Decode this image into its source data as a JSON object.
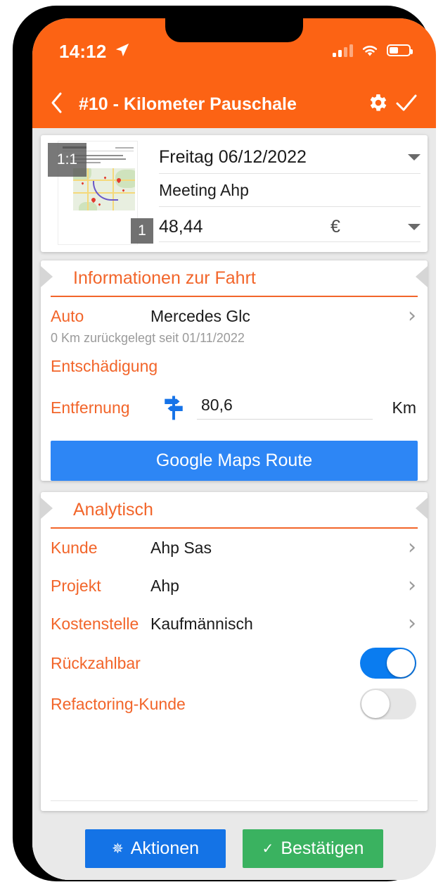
{
  "statusbar": {
    "time": "14:12",
    "location_icon": "location-arrow-icon",
    "signal_icon": "cellular-bars-icon",
    "wifi_icon": "wifi-icon",
    "battery_icon": "battery-icon"
  },
  "appbar": {
    "back_icon": "chevron-left-icon",
    "title": "#10 - Kilometer Pauschale",
    "settings_icon": "gear-icon",
    "confirm_icon": "check-icon"
  },
  "header_card": {
    "thumbnail": {
      "ratio_badge": "1:1",
      "page_badge": "1",
      "alt": "document-map-preview"
    },
    "date": "Freitag 06/12/2022",
    "date_caret_icon": "chevron-down-icon",
    "description": "Meeting Ahp",
    "amount": "48,44",
    "currency": "€",
    "currency_caret_icon": "chevron-down-icon"
  },
  "trip_section": {
    "title": "Informationen zur Fahrt",
    "car_label": "Auto",
    "car_value": "Mercedes  Glc",
    "car_chevron_icon": "chevron-right-icon",
    "odometer_note": "0 Km zurückgelegt seit 01/11/2022",
    "compensation_label": "Entschädigung",
    "distance_label": "Entfernung",
    "distance_icon": "signpost-icon",
    "distance_value": "80,6",
    "distance_unit": "Km",
    "maps_button": "Google Maps Route"
  },
  "analytics_section": {
    "title": "Analytisch",
    "rows": [
      {
        "label": "Kunde",
        "value": "Ahp Sas",
        "chevron_icon": "chevron-right-icon"
      },
      {
        "label": "Projekt",
        "value": "Ahp",
        "chevron_icon": "chevron-right-icon"
      },
      {
        "label": "Kostenstelle",
        "value": "Kaufmännisch",
        "chevron_icon": "chevron-right-icon"
      }
    ],
    "toggles": [
      {
        "label": "Rückzahlbar",
        "state": "on"
      },
      {
        "label": "Refactoring-Kunde",
        "state": "off"
      }
    ]
  },
  "footer": {
    "actions_icon": "gear-icon",
    "actions_label": "Aktionen",
    "confirm_icon": "check-icon",
    "confirm_label": "Bestätigen"
  },
  "colors": {
    "accent_orange": "#fc6314",
    "label_orange": "#f2652a",
    "primary_blue": "#2d86f5",
    "toggle_blue": "#0a7cf0",
    "confirm_green": "#3ab260",
    "background_grey": "#e9e9e9"
  }
}
